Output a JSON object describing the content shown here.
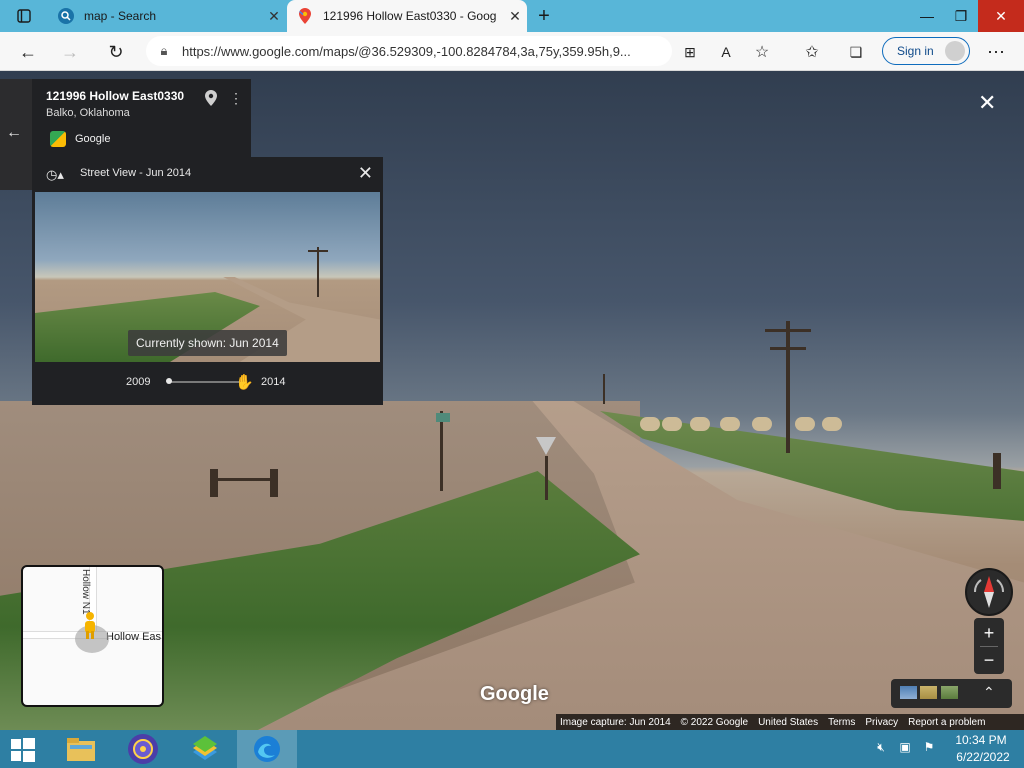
{
  "browser": {
    "tabs": [
      {
        "title": "map - Search",
        "active": false,
        "icon": "search-icon"
      },
      {
        "title": "121996 Hollow East0330 - Goog",
        "active": true,
        "icon": "google-maps-icon"
      }
    ],
    "url": "https://www.google.com/maps/@36.529309,-100.8284784,3a,75y,359.95h,9...",
    "sign_in_label": "Sign in"
  },
  "place_card": {
    "title": "121996 Hollow East0330",
    "subtitle": "Balko, Oklahoma",
    "contributor": "Google"
  },
  "time_machine": {
    "title": "Street View - Jun 2014",
    "caption": "Currently shown: Jun 2014",
    "start_year": "2009",
    "end_year": "2014",
    "slider_value": 1.0
  },
  "minimap": {
    "road_vertical": "Hollow N1",
    "road_horizontal": "Hollow Eas"
  },
  "branding": {
    "logo": "Google"
  },
  "footer": {
    "image_capture": "Image capture: Jun 2014",
    "copyright": "© 2022 Google",
    "country": "United States",
    "terms": "Terms",
    "privacy": "Privacy",
    "report": "Report a problem"
  },
  "taskbar": {
    "time": "10:34 PM",
    "date": "6/22/2022"
  },
  "colors": {
    "tab_strip": "#58b6d8",
    "taskbar": "#2e7fa3",
    "panel": "#202124"
  }
}
